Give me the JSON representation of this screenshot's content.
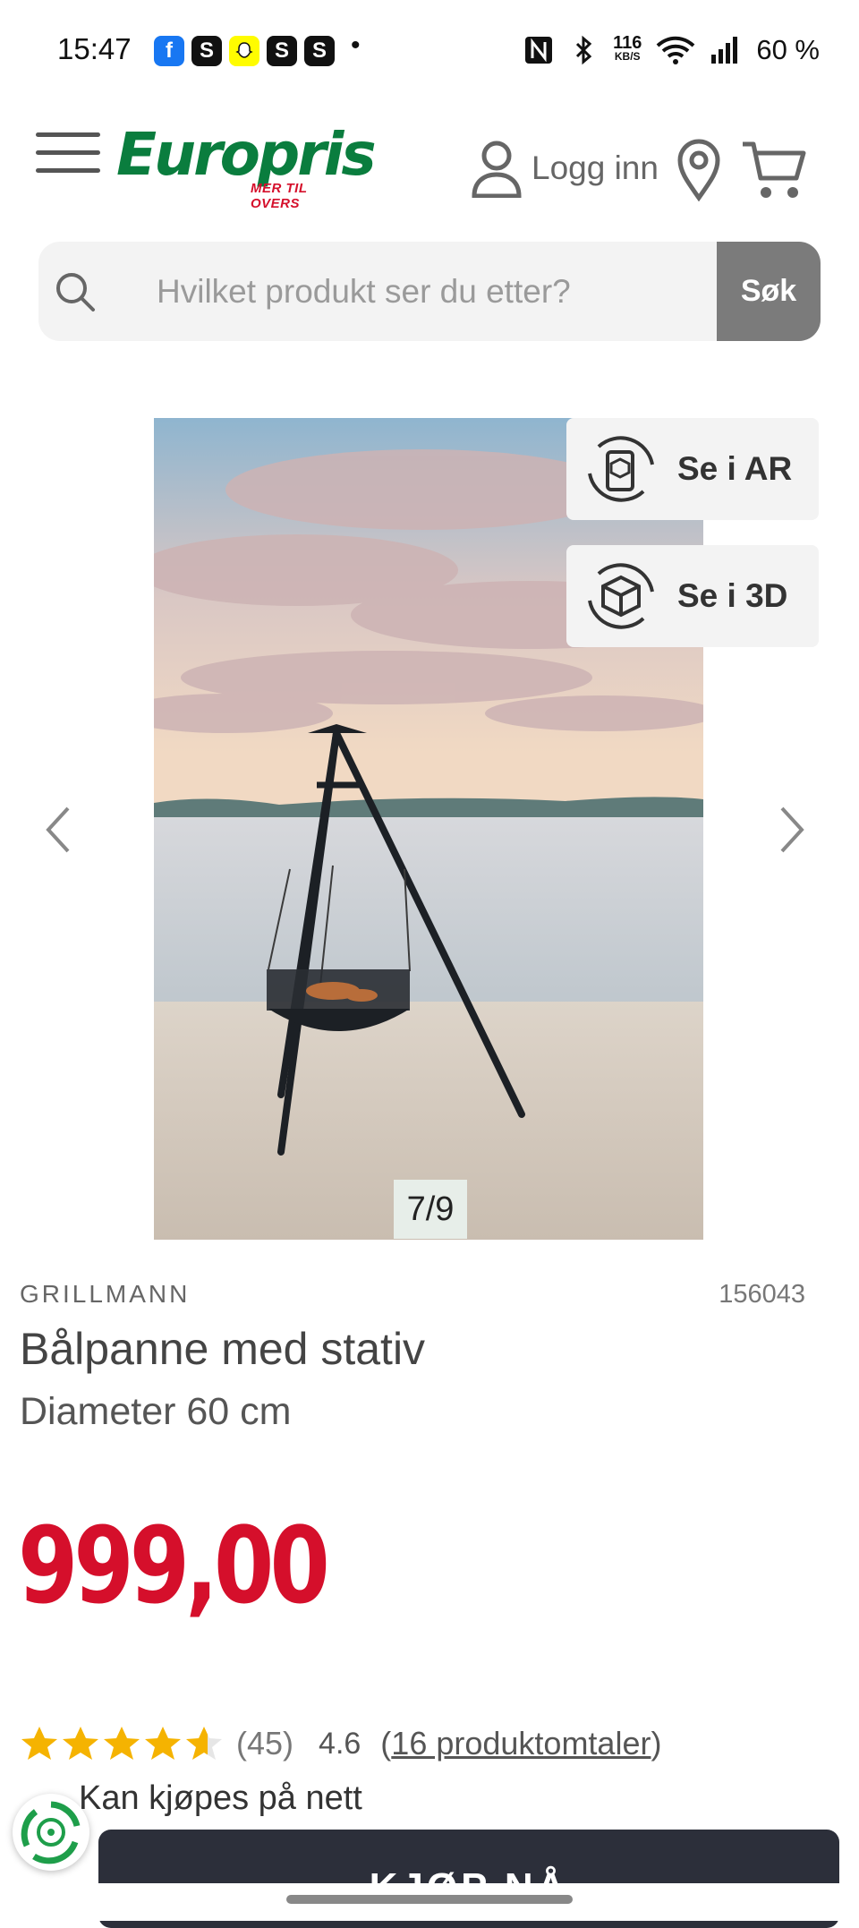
{
  "status_bar": {
    "time": "15:47",
    "apps": [
      "f",
      "S",
      "S",
      "S"
    ],
    "dot": "•",
    "network_speed_value": "116",
    "network_speed_unit": "KB/S",
    "battery": "60 %"
  },
  "header": {
    "logo_text": "Europris",
    "logo_tagline": "MER TIL OVERS",
    "login_label": "Logg inn"
  },
  "search": {
    "placeholder": "Hvilket produkt ser du etter?",
    "button_label": "Søk"
  },
  "gallery": {
    "counter": "7/9",
    "ar_label": "Se i AR",
    "three_d_label": "Se i 3D",
    "current_index": 7,
    "total_images": 9
  },
  "product": {
    "brand": "GRILLMANN",
    "sku": "156043",
    "title": "Bålpanne med stativ",
    "subtitle": "Diameter 60 cm",
    "price": "999,00"
  },
  "rating": {
    "stars_value": 4.6,
    "count": "(45)",
    "value": "4.6",
    "reviews_open": "(",
    "reviews_link": "16 produktomtaler",
    "reviews_close": ")"
  },
  "availability": "Kan kjøpes på nett",
  "buy_button": "KJØP NÅ",
  "colors": {
    "brand_green": "#0a7d3e",
    "price_red": "#d50f2b",
    "star": "#f5b301",
    "buy_button": "#2c2f3a"
  }
}
